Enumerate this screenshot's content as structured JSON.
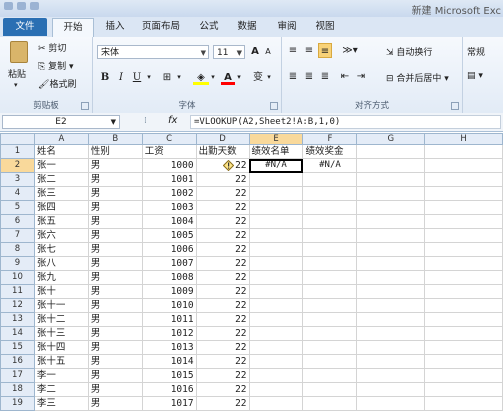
{
  "window_title": "新建 Microsoft Exc",
  "tabs": {
    "file": "文件",
    "home": "开始",
    "insert": "插入",
    "page_layout": "页面布局",
    "formulas": "公式",
    "data": "数据",
    "review": "审阅",
    "view": "视图"
  },
  "clipboard": {
    "paste": "粘贴",
    "cut": "剪切",
    "copy": "复制",
    "format_painter": "格式刷",
    "group_label": "剪贴板"
  },
  "font": {
    "name": "宋体",
    "size": "11",
    "bold": "B",
    "italic": "I",
    "underline": "U",
    "font_color": "A",
    "wen": "变",
    "group_label": "字体",
    "grow": "A",
    "shrink": "A"
  },
  "alignment": {
    "wrap_text": "自动换行",
    "merge_center": "合并后居中",
    "group_label": "对齐方式"
  },
  "number": {
    "format": "常规"
  },
  "formula_bar": {
    "cell_ref": "E2",
    "fx": "fx",
    "formula": "=VLOOKUP(A2,Sheet2!A:B,1,0)"
  },
  "columns": [
    "A",
    "B",
    "C",
    "D",
    "E",
    "F",
    "G",
    "H"
  ],
  "header": [
    "姓名",
    "性别",
    "工资",
    "出勤天数",
    "绩效名单",
    "绩效奖金"
  ],
  "rows": [
    [
      "张一",
      "男",
      "1000",
      "22",
      "#N/A",
      "#N/A"
    ],
    [
      "张二",
      "男",
      "1001",
      "22",
      "",
      ""
    ],
    [
      "张三",
      "男",
      "1002",
      "22",
      "",
      ""
    ],
    [
      "张四",
      "男",
      "1003",
      "22",
      "",
      ""
    ],
    [
      "张五",
      "男",
      "1004",
      "22",
      "",
      ""
    ],
    [
      "张六",
      "男",
      "1005",
      "22",
      "",
      ""
    ],
    [
      "张七",
      "男",
      "1006",
      "22",
      "",
      ""
    ],
    [
      "张八",
      "男",
      "1007",
      "22",
      "",
      ""
    ],
    [
      "张九",
      "男",
      "1008",
      "22",
      "",
      ""
    ],
    [
      "张十",
      "男",
      "1009",
      "22",
      "",
      ""
    ],
    [
      "张十一",
      "男",
      "1010",
      "22",
      "",
      ""
    ],
    [
      "张十二",
      "男",
      "1011",
      "22",
      "",
      ""
    ],
    [
      "张十三",
      "男",
      "1012",
      "22",
      "",
      ""
    ],
    [
      "张十四",
      "男",
      "1013",
      "22",
      "",
      ""
    ],
    [
      "张十五",
      "男",
      "1014",
      "22",
      "",
      ""
    ],
    [
      "李一",
      "男",
      "1015",
      "22",
      "",
      ""
    ],
    [
      "李二",
      "男",
      "1016",
      "22",
      "",
      ""
    ],
    [
      "李三",
      "男",
      "1017",
      "22",
      "",
      ""
    ]
  ],
  "row_numbers": [
    "1",
    "2",
    "3",
    "4",
    "5",
    "6",
    "7",
    "8",
    "9",
    "10",
    "11",
    "12",
    "13",
    "14",
    "15",
    "16",
    "17",
    "18",
    "19"
  ],
  "colors": {
    "file_tab": "#2a6fb3",
    "selection_header": "#f9d99b",
    "font_color_bar": "#ff0000",
    "fill_color_bar": "#ffff00"
  }
}
